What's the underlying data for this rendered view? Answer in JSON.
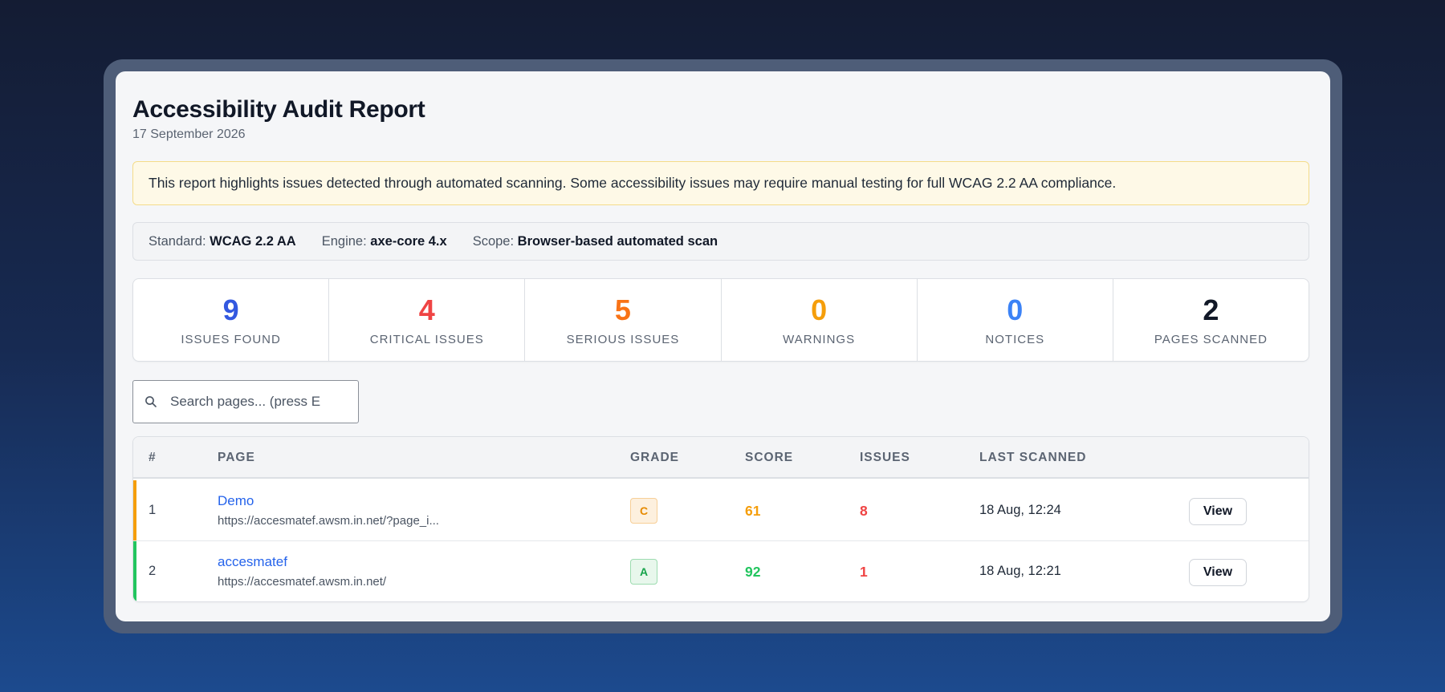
{
  "report": {
    "title": "Accessibility Audit Report",
    "date": "17 September 2026"
  },
  "notice": "This report highlights issues detected through automated scanning. Some accessibility issues may require manual testing for full WCAG 2.2 AA compliance.",
  "meta": {
    "standard_label": "Standard:",
    "standard_value": "WCAG 2.2 AA",
    "engine_label": "Engine:",
    "engine_value": "axe-core 4.x",
    "scope_label": "Scope:",
    "scope_value": "Browser-based automated scan"
  },
  "stats": [
    {
      "value": "9",
      "label": "ISSUES FOUND",
      "color": "#3358e0"
    },
    {
      "value": "4",
      "label": "CRITICAL ISSUES",
      "color": "#ef4444"
    },
    {
      "value": "5",
      "label": "SERIOUS ISSUES",
      "color": "#f97316"
    },
    {
      "value": "0",
      "label": "WARNINGS",
      "color": "#f59e0b"
    },
    {
      "value": "0",
      "label": "NOTICES",
      "color": "#3b82f6"
    },
    {
      "value": "2",
      "label": "PAGES SCANNED",
      "color": "#111827"
    }
  ],
  "search": {
    "placeholder": "Search pages... (press E",
    "icon": "search-icon"
  },
  "table": {
    "headers": {
      "num": "#",
      "page": "PAGE",
      "grade": "GRADE",
      "score": "SCORE",
      "issues": "ISSUES",
      "last_scanned": "LAST SCANNED"
    },
    "rows": [
      {
        "num": "1",
        "name": "Demo",
        "url": "https://accesmatef.awsm.in.net/?page_i...",
        "grade": "C",
        "score": "61",
        "issues": "8",
        "last_scanned": "18 Aug, 12:24",
        "action": "View",
        "accent_color": "#f59e0b",
        "grade_bg": "#fdf0de",
        "grade_border": "#f7cf97",
        "grade_color": "#e68a00",
        "score_color": "#f59e0b"
      },
      {
        "num": "2",
        "name": "accesmatef",
        "url": "https://accesmatef.awsm.in.net/",
        "grade": "A",
        "score": "92",
        "issues": "1",
        "last_scanned": "18 Aug, 12:21",
        "action": "View",
        "accent_color": "#22c55e",
        "grade_bg": "#e8f7ec",
        "grade_border": "#9ddcb0",
        "grade_color": "#16a34a",
        "score_color": "#22c55e"
      }
    ]
  }
}
